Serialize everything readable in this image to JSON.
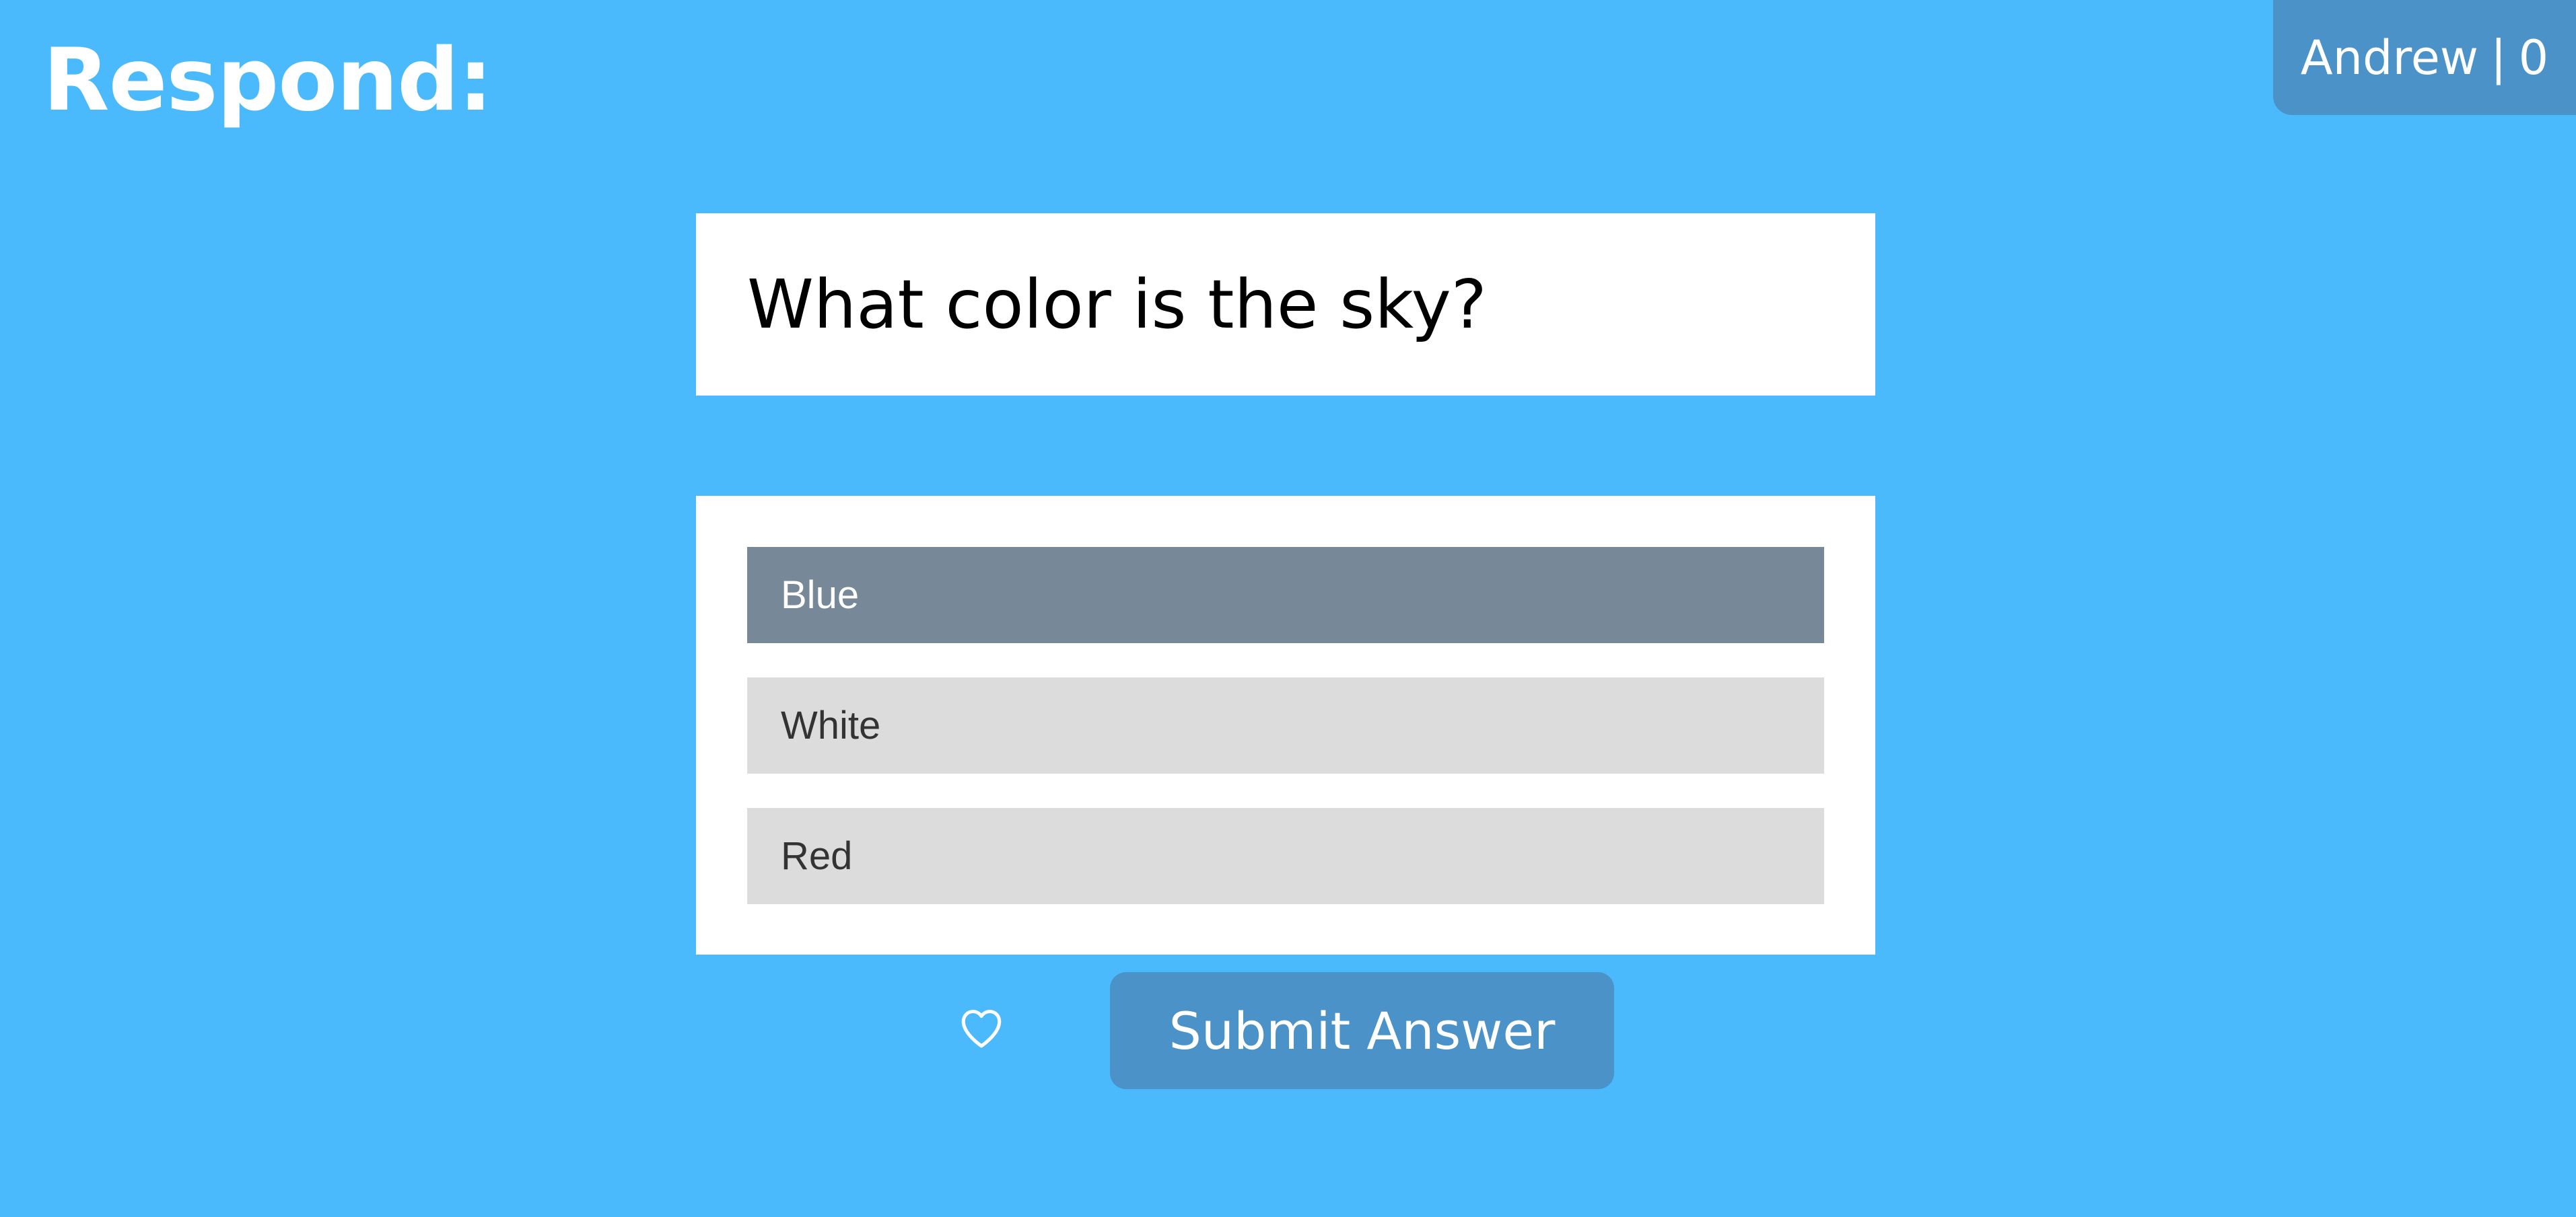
{
  "header": {
    "title": "Respond:"
  },
  "user": {
    "name": "Andrew",
    "separator": "|",
    "score": "0"
  },
  "question": {
    "text": "What color is the sky?"
  },
  "answers": {
    "selected_index": 0,
    "options": [
      {
        "label": "Blue",
        "selected": true
      },
      {
        "label": "White",
        "selected": false
      },
      {
        "label": "Red",
        "selected": false
      }
    ]
  },
  "actions": {
    "favorite_icon": "heart-outline-icon",
    "submit_label": "Submit Answer"
  },
  "colors": {
    "background": "#4abafc",
    "accent": "#4a92c8",
    "selected_option": "#778899",
    "unselected_option": "#dcdcdc",
    "card": "#ffffff"
  }
}
